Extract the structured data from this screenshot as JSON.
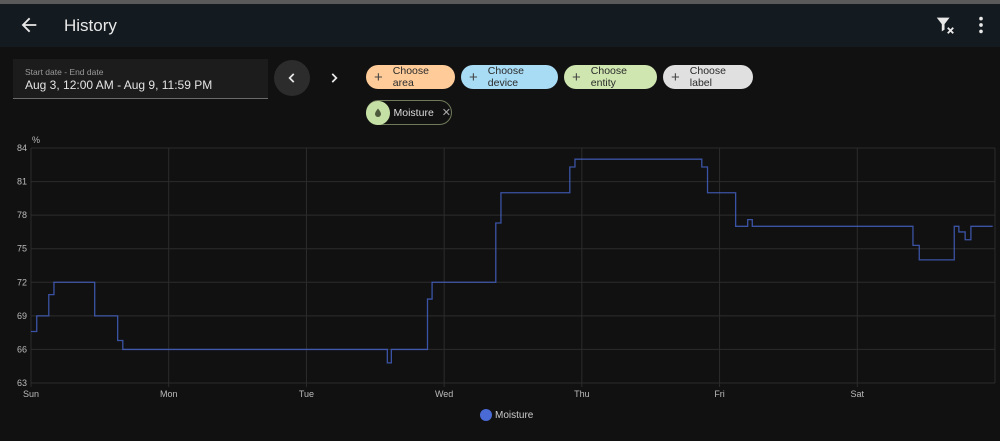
{
  "header": {
    "title": "History",
    "back_icon": "arrow-left-icon",
    "filter_clear_icon": "filter-remove-icon",
    "menu_icon": "dots-vertical-icon"
  },
  "date_picker": {
    "label": "Start date - End date",
    "value": "Aug 3, 12:00 AM - Aug 9, 11:59 PM"
  },
  "chips": [
    {
      "label": "Choose area",
      "color": "#ffcc99"
    },
    {
      "label": "Choose device",
      "color": "#a8dcf5"
    },
    {
      "label": "Choose entity",
      "color": "#cfe6b0"
    },
    {
      "label": "Choose label",
      "color": "#e0e0e0"
    }
  ],
  "selected": {
    "label": "Moisture",
    "icon": "water-percent-icon"
  },
  "chart_data": {
    "type": "line",
    "title": "",
    "ylabel": "%",
    "ylim": [
      63,
      84
    ],
    "yticks": [
      63,
      66,
      69,
      72,
      75,
      78,
      81,
      84
    ],
    "xlim_hours": [
      0,
      168
    ],
    "xticks": [
      {
        "label": "Sun",
        "h": 0
      },
      {
        "label": "Mon",
        "h": 24
      },
      {
        "label": "Tue",
        "h": 48
      },
      {
        "label": "Wed",
        "h": 72
      },
      {
        "label": "Thu",
        "h": 96
      },
      {
        "label": "Fri",
        "h": 120
      },
      {
        "label": "Sat",
        "h": 144
      }
    ],
    "grid": true,
    "legend_position": "bottom",
    "series": [
      {
        "name": "Moisture",
        "color": "#4a6ad6",
        "step": true,
        "points": [
          [
            0,
            67.6
          ],
          [
            1,
            69
          ],
          [
            3.1,
            70.9
          ],
          [
            4,
            72
          ],
          [
            11.1,
            69
          ],
          [
            15.1,
            66.8
          ],
          [
            16,
            66
          ],
          [
            62.1,
            64.8
          ],
          [
            62.8,
            66
          ],
          [
            69.1,
            70.5
          ],
          [
            69.9,
            72
          ],
          [
            81,
            77.3
          ],
          [
            81.9,
            80
          ],
          [
            93.9,
            82.3
          ],
          [
            94.8,
            83
          ],
          [
            116.9,
            82.3
          ],
          [
            117.9,
            80
          ],
          [
            122.8,
            77
          ],
          [
            124.9,
            77.6
          ],
          [
            125.7,
            77
          ],
          [
            153.7,
            75.3
          ],
          [
            154.8,
            74
          ],
          [
            160.9,
            77
          ],
          [
            161.7,
            76.5
          ],
          [
            162.8,
            75.8
          ],
          [
            163.8,
            77
          ],
          [
            167.6,
            77
          ]
        ]
      }
    ]
  }
}
